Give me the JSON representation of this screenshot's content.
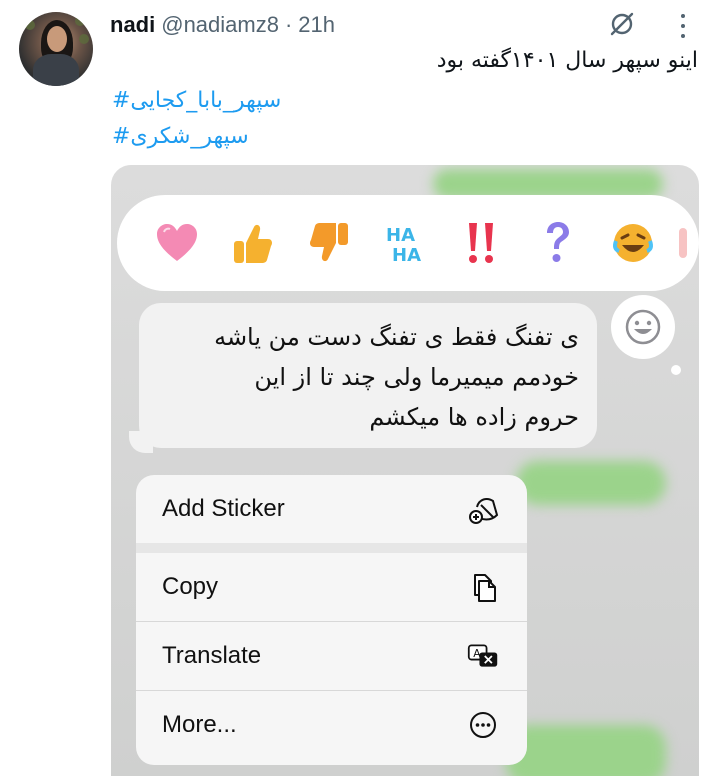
{
  "tweet": {
    "author_name": "nadi",
    "author_handle": "@nadiamz8",
    "separator": "·",
    "time": "21h",
    "text": "اینو سپهر سال ۱۴۰۱گفته بود",
    "hashtags": [
      "سپهر_بابا_کجایی#",
      "سپهر_شکری#"
    ]
  },
  "media": {
    "reactions": [
      {
        "icon": "heart-icon",
        "color": "#f48ab4"
      },
      {
        "icon": "thumbs-up-icon",
        "color": "#f5b12f"
      },
      {
        "icon": "thumbs-down-icon",
        "color": "#f39a2a"
      },
      {
        "icon": "haha-icon",
        "color": "#3bb5e8",
        "text": "HA"
      },
      {
        "icon": "double-exclamation-icon",
        "color": "#e8344e"
      },
      {
        "icon": "question-icon",
        "color": "#8b7be8"
      },
      {
        "icon": "laughing-face-icon",
        "color": "#f5b12f"
      }
    ],
    "message_lines": [
      "ی تفنگ  فقط ی تفنگ دست من یاشه",
      "خودمم میمیرما ولی  چند تا از این",
      "حروم زاده ها میکشم"
    ],
    "menu": {
      "add_sticker": "Add Sticker",
      "copy": "Copy",
      "translate": "Translate",
      "more": "More..."
    }
  }
}
